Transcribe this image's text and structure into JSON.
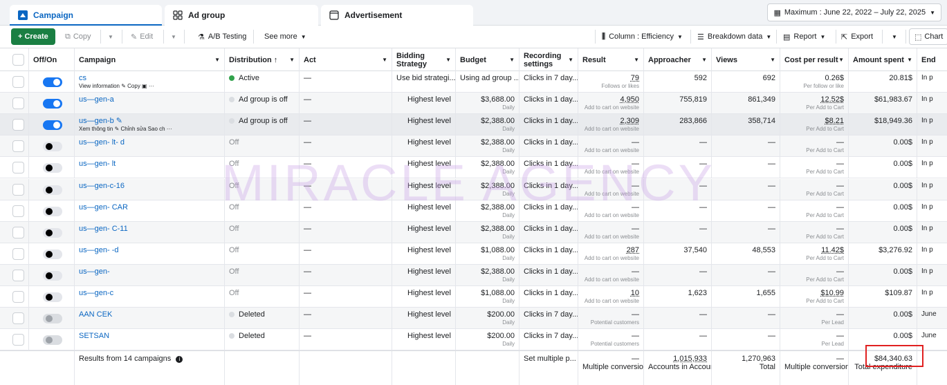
{
  "tabs": [
    {
      "label": "Campaign"
    },
    {
      "label": "Ad group"
    },
    {
      "label": "Advertisement"
    }
  ],
  "date_range": "Maximum : June 22, 2022 – July 22, 2025",
  "toolbar": {
    "create": "+ Create",
    "copy": "Copy",
    "edit": "Edit",
    "ab_testing": "A/B Testing",
    "see_more": "See more",
    "column": "Column : Efficiency",
    "breakdown": "Breakdown data",
    "report": "Report",
    "export": "Export",
    "chart": "Chart"
  },
  "headers": {
    "offon": "Off/On",
    "campaign": "Campaign",
    "distribution": "Distribution ↑",
    "act": "Act",
    "bidding": "Bidding Strategy",
    "budget": "Budget",
    "recording": "Recording settings",
    "result": "Result",
    "approacher": "Approacher",
    "views": "Views",
    "cpr": "Cost per result",
    "amount": "Amount spent",
    "end": "End"
  },
  "rows": [
    {
      "toggle": "on",
      "name": "cs",
      "actions": "View information  ✎  Copy  ▣  ···",
      "dist": "Active",
      "dist_color": "#31a24c",
      "act": "—",
      "bid": "Use bid strategi...",
      "bid_left": true,
      "budget": "Using ad group ...",
      "budget_sub": "",
      "budget_left": true,
      "rec": "Clicks in 7 day...",
      "result": "79",
      "result_sub": "Follows or likes",
      "appr": "592",
      "views": "692",
      "cpr": "0.26$",
      "cpr_sub": "Per follow or like",
      "amount": "20.81$",
      "end": "In p"
    },
    {
      "toggle": "on",
      "name": "us—gen-a",
      "actions": "",
      "dist": "Ad group is off",
      "dist_color": "#dadde1",
      "act": "—",
      "bid": "Highest level",
      "budget": "$3,688.00",
      "budget_sub": "Daily",
      "rec": "Clicks in 1 day...",
      "result": "4,950",
      "result_sub": "Add to cart on website",
      "appr": "755,819",
      "views": "861,349",
      "cpr": "12.52$",
      "cpr_sub": "Per Add to Cart",
      "amount": "$61,983.67",
      "end": "In p"
    },
    {
      "toggle": "on",
      "name": "us—gen-b ✎",
      "actions": "Xem thông tin  ✎ Chỉnh sửa  Sao ch  ···",
      "dist": "Ad group is off",
      "dist_color": "#dadde1",
      "act": "—",
      "bid": "Highest level",
      "budget": "$2,388.00",
      "budget_sub": "Daily",
      "rec": "Clicks in 1 day...",
      "result": "2,309",
      "result_sub": "Add to cart on website",
      "appr": "283,866",
      "views": "358,714",
      "cpr": "$8.21",
      "cpr_sub": "Per Add to Cart",
      "amount": "$18,949.36",
      "end": "In p"
    },
    {
      "toggle": "off",
      "name": "us—gen- lt- d",
      "actions": "",
      "dist": "Off",
      "dist_color": "",
      "act": "—",
      "bid": "Highest level",
      "budget": "$2,388.00",
      "budget_sub": "Daily",
      "rec": "Clicks in 1 day...",
      "result": "—",
      "result_sub": "Add to cart on website",
      "appr": "—",
      "views": "—",
      "cpr": "—",
      "cpr_sub": "Per Add to Cart",
      "amount": "0.00$",
      "end": "In p"
    },
    {
      "toggle": "off",
      "name": "us—gen- lt",
      "actions": "",
      "dist": "Off",
      "dist_color": "",
      "act": "—",
      "bid": "Highest level",
      "budget": "$2,388.00",
      "budget_sub": "Daily",
      "rec": "Clicks in 1 day...",
      "result": "—",
      "result_sub": "Add to cart on website",
      "appr": "—",
      "views": "—",
      "cpr": "—",
      "cpr_sub": "Per Add to Cart",
      "amount": "0.00$",
      "end": "In p"
    },
    {
      "toggle": "off",
      "name": "us—gen-c-16",
      "actions": "",
      "dist": "Off",
      "dist_color": "",
      "act": "—",
      "bid": "Highest level",
      "budget": "$2,388.00",
      "budget_sub": "Daily",
      "rec": "Clicks in 1 day...",
      "result": "—",
      "result_sub": "Add to cart on website",
      "appr": "—",
      "views": "—",
      "cpr": "—",
      "cpr_sub": "Per Add to Cart",
      "amount": "0.00$",
      "end": "In p"
    },
    {
      "toggle": "off",
      "name": "us—gen- CAR",
      "actions": "",
      "dist": "Off",
      "dist_color": "",
      "act": "—",
      "bid": "Highest level",
      "budget": "$2,388.00",
      "budget_sub": "Daily",
      "rec": "Clicks in 1 day...",
      "result": "—",
      "result_sub": "Add to cart on website",
      "appr": "—",
      "views": "—",
      "cpr": "—",
      "cpr_sub": "Per Add to Cart",
      "amount": "0.00$",
      "end": "In p"
    },
    {
      "toggle": "off",
      "name": "us—gen- C-11",
      "actions": "",
      "dist": "Off",
      "dist_color": "",
      "act": "—",
      "bid": "Highest level",
      "budget": "$2,388.00",
      "budget_sub": "Daily",
      "rec": "Clicks in 1 day...",
      "result": "—",
      "result_sub": "Add to cart on website",
      "appr": "—",
      "views": "—",
      "cpr": "—",
      "cpr_sub": "Per Add to Cart",
      "amount": "0.00$",
      "end": "In p"
    },
    {
      "toggle": "off",
      "name": "us—gen- -d",
      "actions": "",
      "dist": "Off",
      "dist_color": "",
      "act": "—",
      "bid": "Highest level",
      "budget": "$1,088.00",
      "budget_sub": "Daily",
      "rec": "Clicks in 1 day...",
      "result": "287",
      "result_sub": "Add to cart on website",
      "appr": "37,540",
      "views": "48,553",
      "cpr": "11.42$",
      "cpr_sub": "Per Add to Cart",
      "amount": "$3,276.92",
      "end": "In p"
    },
    {
      "toggle": "off",
      "name": "us—gen-",
      "actions": "",
      "dist": "Off",
      "dist_color": "",
      "act": "—",
      "bid": "Highest level",
      "budget": "$2,388.00",
      "budget_sub": "Daily",
      "rec": "Clicks in 1 day...",
      "result": "—",
      "result_sub": "Add to cart on website",
      "appr": "—",
      "views": "—",
      "cpr": "—",
      "cpr_sub": "Per Add to Cart",
      "amount": "0.00$",
      "end": "In p"
    },
    {
      "toggle": "off",
      "name": "us—gen-c",
      "actions": "",
      "dist": "Off",
      "dist_color": "",
      "act": "—",
      "bid": "Highest level",
      "budget": "$1,088.00",
      "budget_sub": "Daily",
      "rec": "Clicks in 1 day...",
      "result": "10",
      "result_sub": "Add to cart on website",
      "appr": "1,623",
      "views": "1,655",
      "cpr": "$10.99",
      "cpr_sub": "Per Add to Cart",
      "amount": "$109.87",
      "end": "In p"
    },
    {
      "toggle": "dis",
      "name": "AAN CEK",
      "actions": "",
      "dist": "Deleted",
      "dist_color": "#dadde1",
      "act": "—",
      "bid": "Highest level",
      "budget": "$200.00",
      "budget_sub": "Daily",
      "rec": "Clicks in 7 day...",
      "result": "—",
      "result_sub": "Potential customers",
      "appr": "—",
      "views": "—",
      "cpr": "—",
      "cpr_sub": "Per Lead",
      "amount": "0.00$",
      "end": "June"
    },
    {
      "toggle": "dis",
      "name": "SETSAN",
      "actions": "",
      "dist": "Deleted",
      "dist_color": "#dadde1",
      "act": "—",
      "bid": "Highest level",
      "budget": "$200.00",
      "budget_sub": "Daily",
      "rec": "Clicks in 7 day...",
      "result": "—",
      "result_sub": "Potential customers",
      "appr": "—",
      "views": "—",
      "cpr": "—",
      "cpr_sub": "Per Lead",
      "amount": "0.00$",
      "end": "June"
    }
  ],
  "footer": {
    "label": "Results from 14 campaigns",
    "rec": "Set multiple p...",
    "result": "—",
    "result_sub": "Multiple conversions",
    "appr": "1,015,933",
    "appr_sub": "Accounts in Account ...",
    "views": "1,270,963",
    "views_sub": "Total",
    "cpr": "—",
    "cpr_sub": "Multiple conversions",
    "amount": "$84,340.63",
    "amount_sub": "Total expenditure"
  },
  "watermark": "MIRACLE AGENCY",
  "colors": {
    "accent": "#0a66c2",
    "create": "#1a7f43",
    "highlight": "#e02020"
  }
}
